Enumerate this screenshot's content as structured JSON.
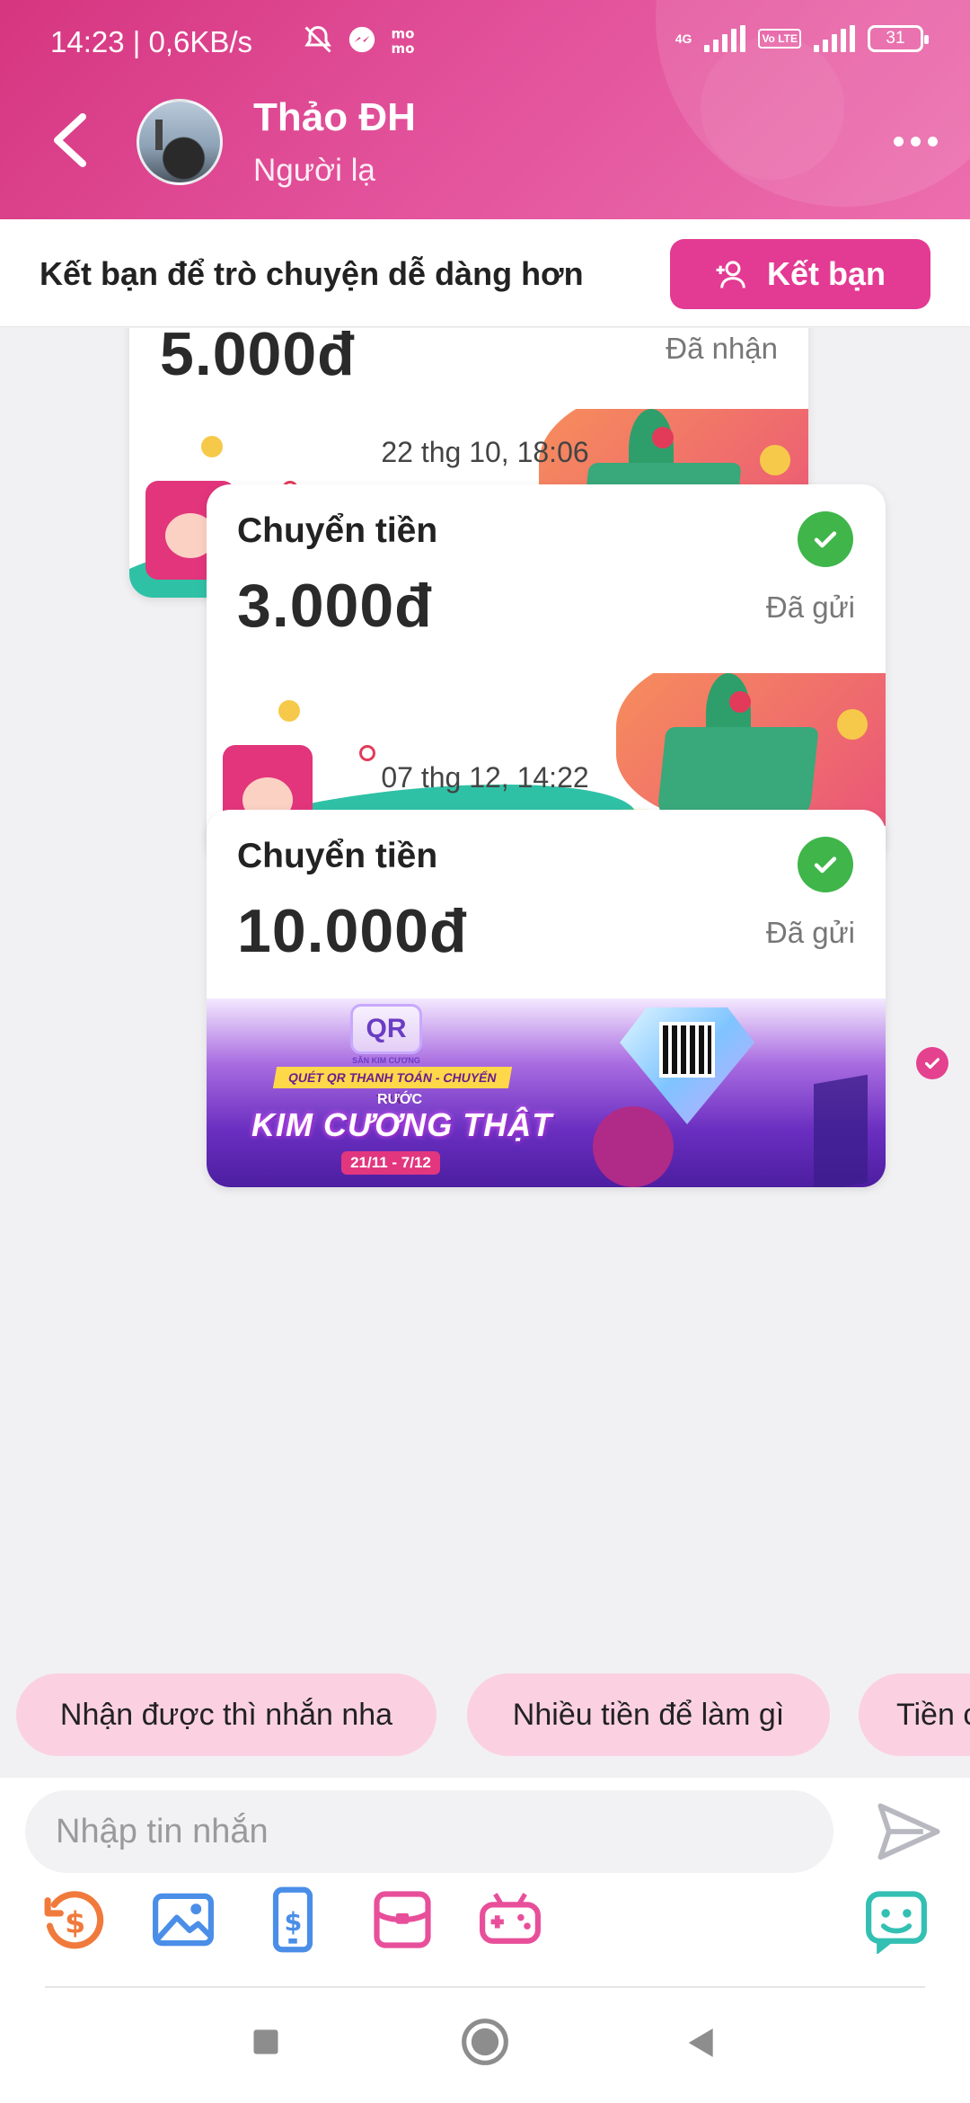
{
  "status_bar": {
    "time": "14:23 | 0,6KB/s",
    "net_label": "4G",
    "volte": "Vo LTE",
    "battery": "31"
  },
  "header": {
    "contact_name": "Thảo ĐH",
    "contact_subtitle": "Người lạ"
  },
  "friend_bar": {
    "text": "Kết bạn để trò chuyện dễ dàng hơn",
    "button_label": "Kết bạn"
  },
  "messages": [
    {
      "amount": "5.000đ",
      "status": "Đã nhận"
    },
    {
      "timestamp": "22 thg 10, 18:06",
      "title": "Chuyển tiền",
      "amount": "3.000đ",
      "status": "Đã gửi"
    },
    {
      "timestamp": "07 thg 12, 14:22",
      "title": "Chuyển tiền",
      "amount": "10.000đ",
      "status": "Đã gửi",
      "banner": {
        "logo": "QR",
        "logo_sub": "SĂN KIM CƯƠNG",
        "strip": "QUÉT QR THANH TOÁN - CHUYỂN TRẢ",
        "rc": "RƯỚC",
        "headline": "KIM CƯƠNG THẬT",
        "date": "21/11 - 7/12"
      }
    }
  ],
  "quick_replies": [
    "Nhận được thì nhắn nha",
    "Nhiều tiền để làm gì",
    "Tiền c"
  ],
  "composer": {
    "placeholder": "Nhập tin nhắn"
  },
  "colors": {
    "brand": "#e33a93",
    "check_green": "#3fb54a",
    "chip_bg": "#fbd1e2"
  }
}
